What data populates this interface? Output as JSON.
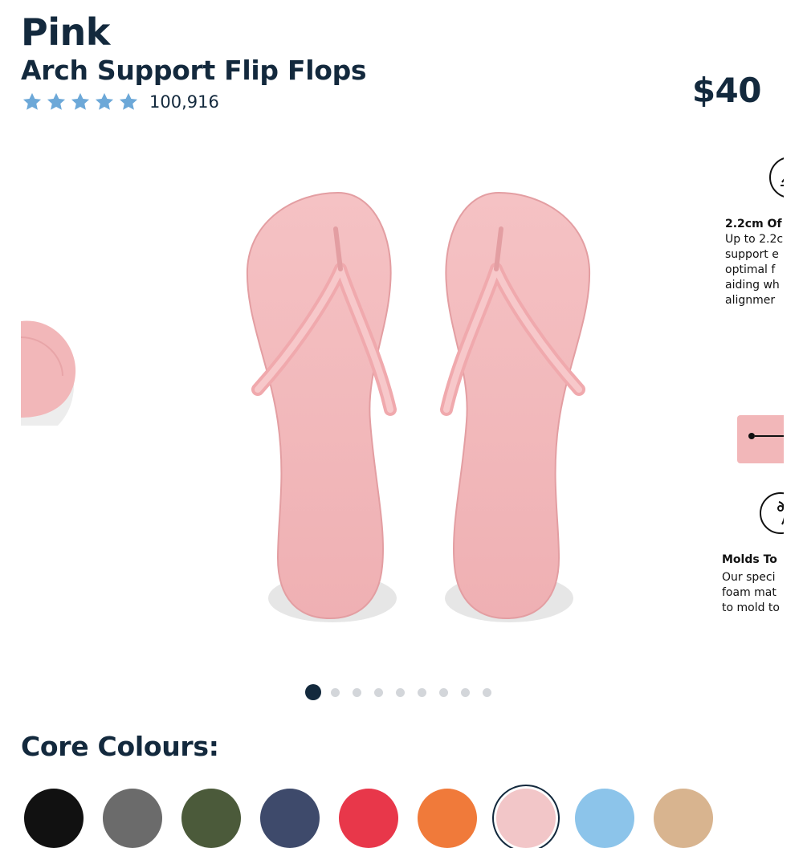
{
  "product": {
    "colour_name": "Pink",
    "name": "Arch Support Flip Flops",
    "price": "$40",
    "rating_stars": 5,
    "rating_count": "100,916"
  },
  "colors": {
    "text_primary": "#13293d",
    "star": "#6ca8d8",
    "product_pink": "#f2b7b9"
  },
  "carousel": {
    "slide_count": 9,
    "active_index": 0,
    "next_slide_features": [
      {
        "icon": "arch-support-icon",
        "title": "2.2cm Of",
        "lines": [
          "Up to 2.2c",
          "support e",
          "optimal f",
          "aiding wh",
          "alignmer"
        ]
      },
      {
        "icon": "foot-mold-icon",
        "title": "Molds To",
        "lines": [
          "Our speci",
          "foam mat",
          "to mold to"
        ]
      }
    ]
  },
  "core_colours": {
    "heading": "Core Colours:",
    "swatches": [
      {
        "name": "black",
        "hex": "#111111"
      },
      {
        "name": "grey",
        "hex": "#6b6b6b"
      },
      {
        "name": "olive",
        "hex": "#4b5a3a"
      },
      {
        "name": "navy",
        "hex": "#3e4a6b"
      },
      {
        "name": "red",
        "hex": "#e8374a"
      },
      {
        "name": "orange",
        "hex": "#f07a3a"
      },
      {
        "name": "pink",
        "hex": "#f2c6c8",
        "selected": true
      },
      {
        "name": "light-blue",
        "hex": "#8cc4ea"
      },
      {
        "name": "sand",
        "hex": "#d8b48f"
      }
    ]
  }
}
